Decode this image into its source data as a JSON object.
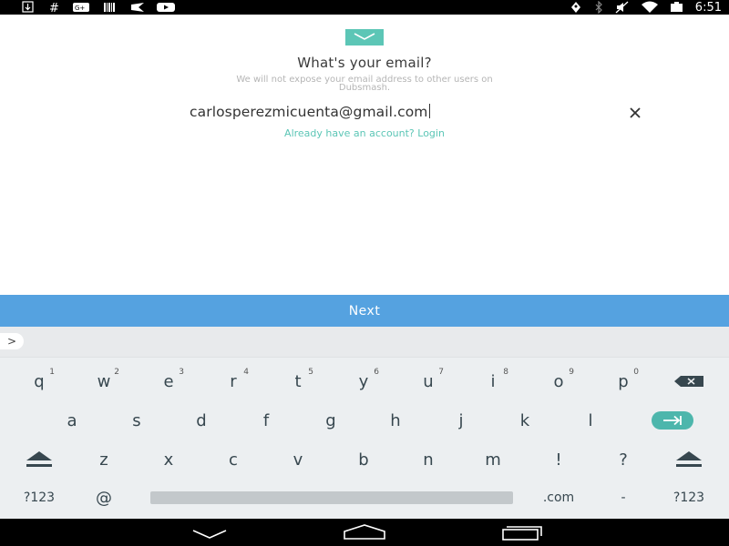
{
  "status_bar": {
    "time": "6:51",
    "left_icons": [
      "download-icon",
      "hash-icon",
      "google-plus-icon",
      "barcode-icon",
      "plane-icon",
      "youtube-icon"
    ],
    "right_icons": [
      "location-icon",
      "bluetooth-icon",
      "mute-icon",
      "wifi-icon",
      "battery-icon"
    ]
  },
  "email_screen": {
    "title": "What's your email?",
    "subtitle": "We will not expose your email address to other users on Dubsmash.",
    "email_value": "carlosperezmicuenta@gmail.com",
    "login_link": "Already have an account? Login",
    "accent_color": "#5cc6b6"
  },
  "next_button": {
    "label": "Next",
    "color": "#55a2e0"
  },
  "suggestion_strip": {
    "expand_label": ">"
  },
  "keyboard": {
    "row1": [
      {
        "key": "q",
        "hint": "1"
      },
      {
        "key": "w",
        "hint": "2"
      },
      {
        "key": "e",
        "hint": "3"
      },
      {
        "key": "r",
        "hint": "4"
      },
      {
        "key": "t",
        "hint": "5"
      },
      {
        "key": "y",
        "hint": "6"
      },
      {
        "key": "u",
        "hint": "7"
      },
      {
        "key": "i",
        "hint": "8"
      },
      {
        "key": "o",
        "hint": "9"
      },
      {
        "key": "p",
        "hint": "0"
      }
    ],
    "row2": [
      "a",
      "s",
      "d",
      "f",
      "g",
      "h",
      "j",
      "k",
      "l"
    ],
    "row3": [
      "z",
      "x",
      "c",
      "v",
      "b",
      "n",
      "m",
      "!",
      "?"
    ],
    "row4": {
      "symbols_left": "?123",
      "at": "@",
      "dotcom": ".com",
      "dash": "-",
      "symbols_right": "?123"
    },
    "enter_color": "#4db6ac"
  },
  "nav_bar": {
    "icons": [
      "back-icon",
      "home-icon",
      "recents-icon"
    ]
  }
}
